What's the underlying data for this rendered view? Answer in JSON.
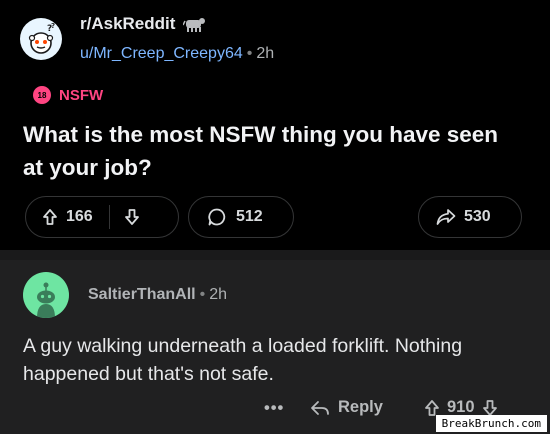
{
  "post": {
    "subreddit": "r/AskReddit",
    "author": "u/Mr_Creep_Creepy64",
    "separator": "•",
    "age": "2h",
    "nsfw_badge_text": "18",
    "nsfw_label": "NSFW",
    "title": "What is the most NSFW thing you have seen at your job?",
    "upvotes": "166",
    "comments": "512",
    "shares": "530"
  },
  "comment": {
    "author": "SaltierThanAll",
    "separator": "•",
    "age": "2h",
    "body": "A guy walking underneath a loaded forklift. Nothing happened but that's not safe.",
    "more_label": "•••",
    "reply_label": "Reply",
    "votes": "910"
  },
  "watermark": "BreakBrunch.com",
  "colors": {
    "background": "#000000",
    "comment_bg": "#202021",
    "nsfw": "#ff4582",
    "username_link": "#7eb6ff",
    "avatar_green": "#6ee5a2"
  }
}
